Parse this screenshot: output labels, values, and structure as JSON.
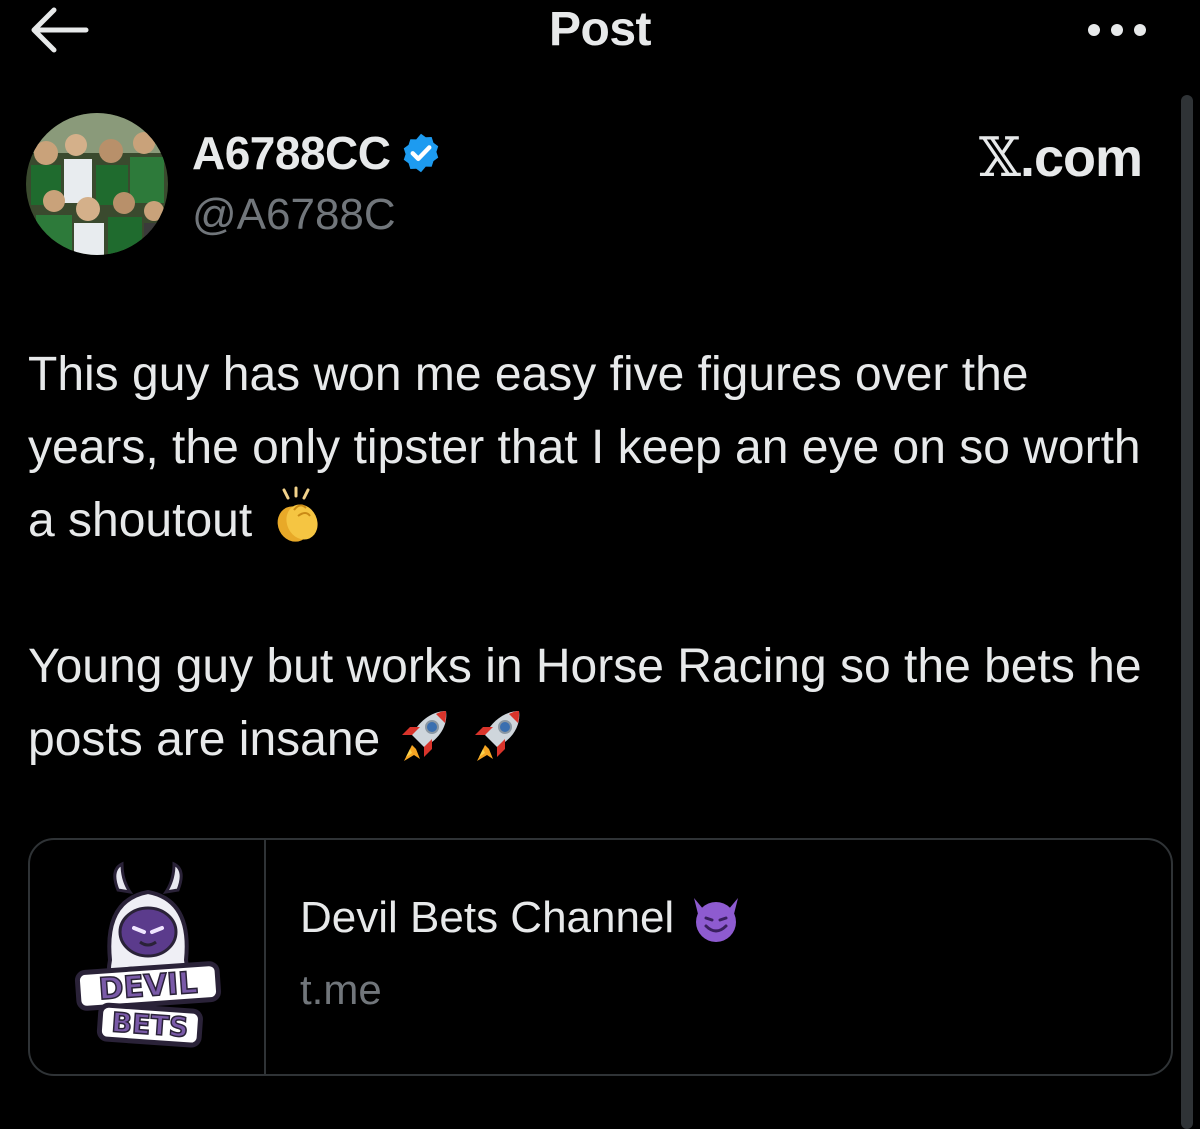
{
  "header": {
    "title": "Post",
    "back_icon": "arrow-left-icon",
    "more_icon": "more-horizontal-icon"
  },
  "author": {
    "display_name": "A6788CC",
    "handle": "@A6788C",
    "verified": true,
    "verified_color": "#1d9bf0"
  },
  "source": {
    "label": ".com",
    "glyph": "𝕏"
  },
  "post": {
    "paragraph1": "This guy has won me easy five figures over the years, the only tipster that I keep an eye on so worth a shoutout",
    "paragraph2": "Young guy but works in Horse Racing so the bets he posts are insane"
  },
  "link_card": {
    "title": "Devil Bets Channel",
    "domain": "t.me",
    "logo_text_line1": "DEVIL",
    "logo_text_line2": "BETS"
  },
  "colors": {
    "background": "#000000",
    "text_primary": "#e7e9ea",
    "text_secondary": "#71767b",
    "border": "#2f3336"
  }
}
